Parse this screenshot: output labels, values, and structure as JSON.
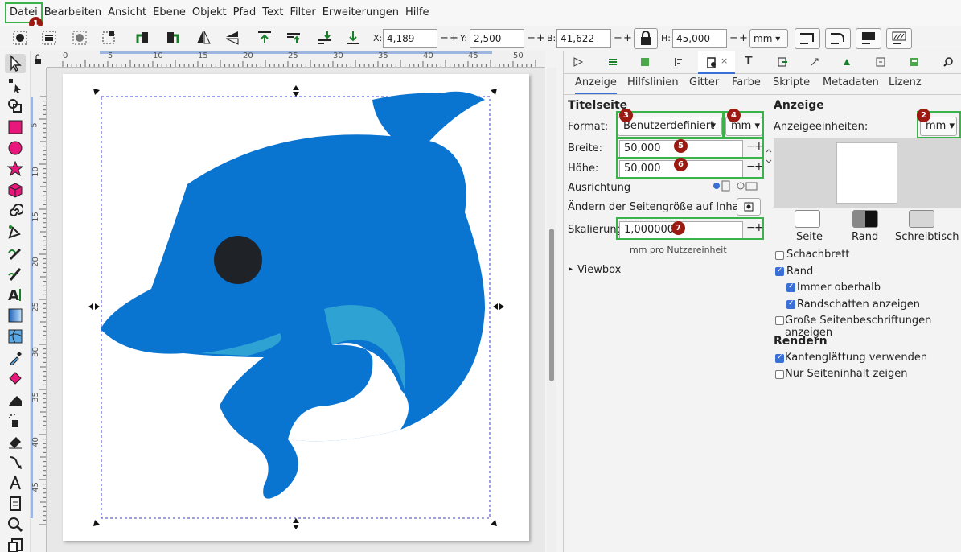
{
  "menu": [
    "Datei",
    "Bearbeiten",
    "Ansicht",
    "Ebene",
    "Objekt",
    "Pfad",
    "Text",
    "Filter",
    "Erweiterungen",
    "Hilfe"
  ],
  "toolbar": {
    "x_label": "X:",
    "x_value": "4,189",
    "y_label": "Y:",
    "y_value": "2,500",
    "w_label": "B:",
    "w_value": "41,622",
    "h_label": "H:",
    "h_value": "45,000",
    "unit": "mm",
    "minus": "−",
    "plus": "+"
  },
  "ruler": {
    "h": [
      "0",
      "5",
      "10",
      "15",
      "20",
      "25",
      "30",
      "35",
      "40",
      "45",
      "50"
    ],
    "v": [
      "5",
      "10",
      "15",
      "20",
      "25",
      "30",
      "35",
      "40",
      "45"
    ]
  },
  "dialog_tabs": {
    "close": "×",
    "text_tool": "T"
  },
  "subtabs": [
    "Anzeige",
    "Hilfslinien",
    "Gitter",
    "Farbe",
    "Skripte",
    "Metadaten",
    "Lizenz"
  ],
  "page_settings": {
    "section_title": "Titelseite",
    "format_label": "Format:",
    "format_value": "Benutzerdefiniert",
    "format_unit": "mm",
    "width_label": "Breite:",
    "width_value": "50,000",
    "height_label": "Höhe:",
    "height_value": "50,000",
    "orientation_label": "Ausrichtung",
    "resize_label": "Ändern der Seitengröße auf Inhalt:",
    "scale_label": "Skalierung:",
    "scale_value": "1,000000",
    "scale_hint": "mm pro Nutzereinheit",
    "viewbox_label": "Viewbox"
  },
  "display": {
    "section_title": "Anzeige",
    "units_label": "Anzeigeeinheiten:",
    "units_value": "mm",
    "swatches": [
      "Seite",
      "Rand",
      "Schreibtisch"
    ],
    "checkboxes": [
      {
        "label": "Schachbrett",
        "checked": false
      },
      {
        "label": "Rand",
        "checked": true
      },
      {
        "label": "Immer oberhalb",
        "checked": true
      },
      {
        "label": "Randschatten anzeigen",
        "checked": true
      },
      {
        "label": "Große Seitenbeschriftungen anzeigen",
        "checked": false
      }
    ],
    "render_title": "Rendern",
    "render_checkboxes": [
      {
        "label": "Kantenglättung verwenden",
        "checked": true
      },
      {
        "label": "Nur Seiteninhalt zeigen",
        "checked": false
      }
    ]
  },
  "badges": [
    "1",
    "2",
    "3",
    "4",
    "5",
    "6",
    "7"
  ],
  "colors": {
    "dolphin_body": "#0a74d1",
    "dolphin_fin_light": "#2ea3d3",
    "eye": "#1f2327",
    "highlight_box": "#3ab44a",
    "badge": "#9b1a12",
    "accent": "#3a6fd8"
  }
}
